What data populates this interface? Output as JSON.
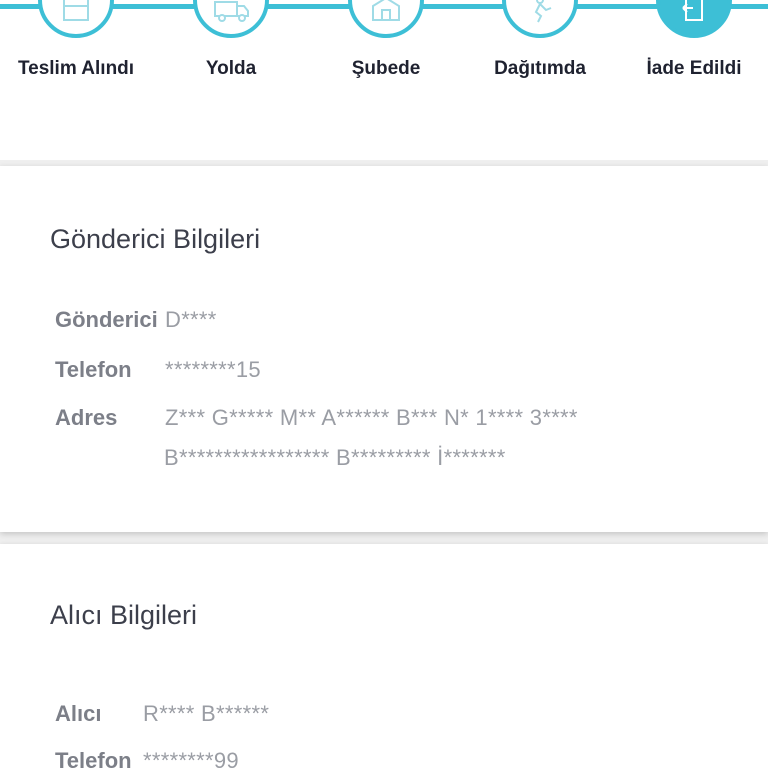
{
  "steps": [
    {
      "label": "Teslim Alındı",
      "icon": "package-icon",
      "active": false
    },
    {
      "label": "Yolda",
      "icon": "truck-icon",
      "active": false
    },
    {
      "label": "Şubede",
      "icon": "branch-icon",
      "active": false
    },
    {
      "label": "Dağıtımda",
      "icon": "courier-icon",
      "active": false
    },
    {
      "label": "İade Edildi",
      "icon": "return-icon",
      "active": true
    }
  ],
  "colors": {
    "accent": "#3dbfd6"
  },
  "sender": {
    "title": "Gönderici Bilgileri",
    "name_label": "Gönderici",
    "name_value": "D****",
    "phone_label": "Telefon",
    "phone_value": "********15",
    "address_label": "Adres",
    "address_line1": "Z*** G***** M** A****** B*** N* 1**** 3****",
    "address_line2": "B***************** B********* İ*******"
  },
  "receiver": {
    "title": "Alıcı Bilgileri",
    "name_label": "Alıcı",
    "name_value": "R**** B******",
    "phone_label": "Telefon",
    "phone_value": "********99"
  }
}
